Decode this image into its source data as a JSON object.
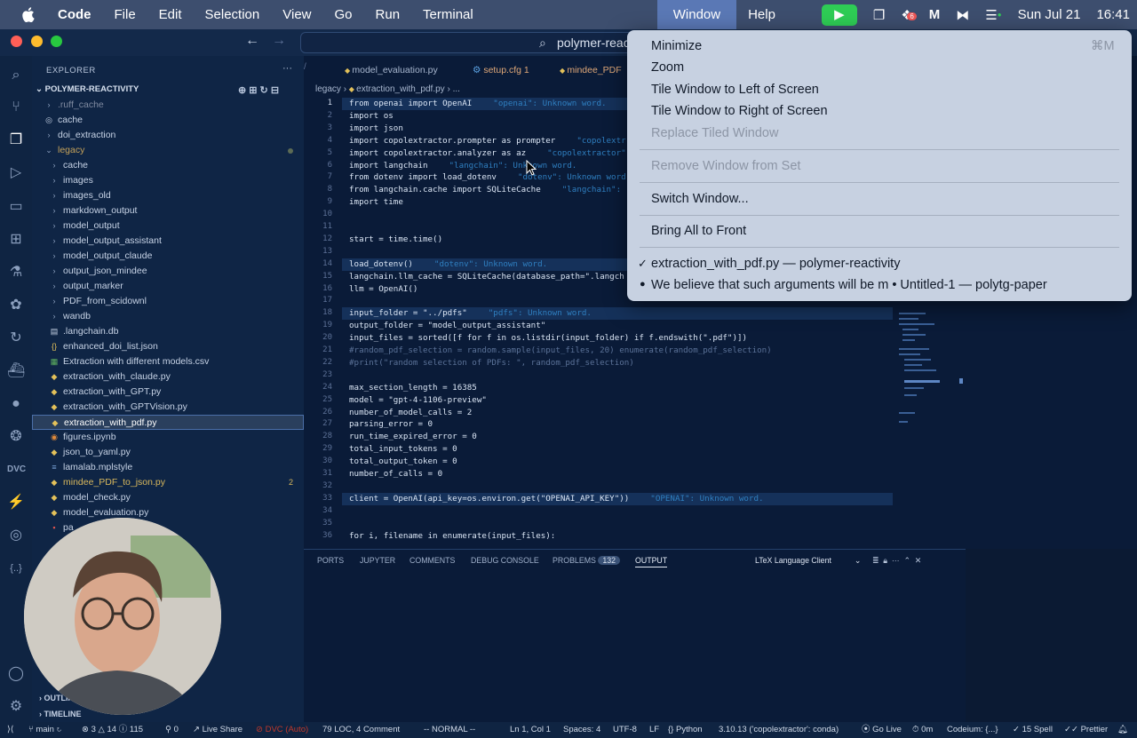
{
  "menubar": {
    "apple": "",
    "app": "Code",
    "items": [
      "File",
      "Edit",
      "Selection",
      "View",
      "Go",
      "Run",
      "Terminal",
      "Window",
      "Help"
    ],
    "date": "Sun Jul 21",
    "time": "16:41",
    "tray_badge": "6"
  },
  "window": {
    "command_center": "polymer-reac",
    "nav_back": "←",
    "nav_forward": "→"
  },
  "sidebar": {
    "title": "EXPLORER",
    "more": "···",
    "project": "POLYMER-REACTIVITY",
    "items": [
      {
        "label": ".ruff_cache",
        "icon": "›",
        "color": "#7f8aa0"
      },
      {
        "label": "cache",
        "icon": "◎",
        "color": "#c7d3e6"
      },
      {
        "label": "doi_extraction",
        "icon": "›",
        "color": "#c7d3e6"
      },
      {
        "label": "legacy",
        "icon": "⌄",
        "color": "#c5a25a"
      },
      {
        "label": "cache",
        "icon": "›",
        "color": "#c7d3e6"
      },
      {
        "label": "images",
        "icon": "›",
        "color": "#c7d3e6"
      },
      {
        "label": "images_old",
        "icon": "›",
        "color": "#c7d3e6"
      },
      {
        "label": "markdown_output",
        "icon": "›",
        "color": "#c7d3e6"
      },
      {
        "label": "model_output",
        "icon": "›",
        "color": "#c7d3e6"
      },
      {
        "label": "model_output_assistant",
        "icon": "›",
        "color": "#c7d3e6"
      },
      {
        "label": "model_output_claude",
        "icon": "›",
        "color": "#c7d3e6"
      },
      {
        "label": "output_json_mindee",
        "icon": "›",
        "color": "#c7d3e6"
      },
      {
        "label": "output_marker",
        "icon": "›",
        "color": "#c7d3e6"
      },
      {
        "label": "PDF_from_scidownl",
        "icon": "›",
        "color": "#c7d3e6"
      },
      {
        "label": "wandb",
        "icon": "›",
        "color": "#c7d3e6"
      },
      {
        "label": ".langchain.db",
        "icon": "▤",
        "color": "#c7d3e6"
      },
      {
        "label": "enhanced_doi_list.json",
        "icon": "{}",
        "color": "#c7d3e6"
      },
      {
        "label": "Extraction with different models.csv",
        "icon": "▦",
        "color": "#c7d3e6"
      },
      {
        "label": "extraction_with_claude.py",
        "icon": "◆",
        "color": "#c7d3e6"
      },
      {
        "label": "extraction_with_GPT.py",
        "icon": "◆",
        "color": "#c7d3e6"
      },
      {
        "label": "extraction_with_GPTVision.py",
        "icon": "◆",
        "color": "#c7d3e6"
      },
      {
        "label": "extraction_with_pdf.py",
        "icon": "◆",
        "color": "#ffffff"
      },
      {
        "label": "figures.ipynb",
        "icon": "◉",
        "color": "#c7d3e6"
      },
      {
        "label": "json_to_yaml.py",
        "icon": "◆",
        "color": "#c7d3e6"
      },
      {
        "label": "lamalab.mplstyle",
        "icon": "≡",
        "color": "#c7d3e6"
      },
      {
        "label": "mindee_PDF_to_json.py",
        "icon": "◆",
        "color": "#d9b85c"
      },
      {
        "label": "model_check.py",
        "icon": "◆",
        "color": "#c7d3e6"
      },
      {
        "label": "model_evaluation.py",
        "icon": "◆",
        "color": "#c7d3e6"
      },
      {
        "label": "pa",
        "icon": "▪",
        "color": "#c7d3e6"
      }
    ],
    "mindee_badge": "2",
    "outline": "OUTLINE",
    "timeline": "TIMELINE"
  },
  "editor": {
    "tabs": [
      {
        "label": "model_evaluation.py",
        "icon": "◆"
      },
      {
        "label": "setup.cfg",
        "badge": "1",
        "icon": "⚙"
      },
      {
        "label": "mindee_PDF",
        "icon": "◆"
      }
    ],
    "breadcrumb": [
      "legacy",
      "extraction_with_pdf.py",
      "..."
    ],
    "lines": [
      {
        "n": "1",
        "code": "from openai import OpenAI",
        "warn": "\"openai\": Unknown word.",
        "hl": true
      },
      {
        "n": "2",
        "code": "import os",
        "warn": ""
      },
      {
        "n": "3",
        "code": "import json",
        "warn": ""
      },
      {
        "n": "4",
        "code": "import copolextractor.prompter as prompter",
        "warn": "\"copolextr"
      },
      {
        "n": "5",
        "code": "import copolextractor.analyzer as az",
        "warn": "\"copolextractor\""
      },
      {
        "n": "6",
        "code": "import langchain",
        "warn": "\"langchain\": Unknown word."
      },
      {
        "n": "7",
        "code": "from dotenv import load_dotenv",
        "warn": "\"dotenv\": Unknown word"
      },
      {
        "n": "8",
        "code": "from langchain.cache import SQLiteCache",
        "warn": "\"langchain\":"
      },
      {
        "n": "9",
        "code": "import time",
        "warn": ""
      },
      {
        "n": "10",
        "code": "",
        "warn": ""
      },
      {
        "n": "11",
        "code": "",
        "warn": ""
      },
      {
        "n": "12",
        "code": "start = time.time()",
        "warn": ""
      },
      {
        "n": "13",
        "code": "",
        "warn": ""
      },
      {
        "n": "14",
        "code": "load_dotenv()",
        "warn": "\"dotenv\": Unknown word.",
        "hl": true
      },
      {
        "n": "15",
        "code": "langchain.llm_cache = SQLiteCache(database_path=\".langch",
        "warn": ""
      },
      {
        "n": "16",
        "code": "llm = OpenAI()",
        "warn": ""
      },
      {
        "n": "17",
        "code": "",
        "warn": ""
      },
      {
        "n": "18",
        "code": "input_folder = \"../pdfs\"",
        "warn": "\"pdfs\": Unknown word.",
        "hl": true
      },
      {
        "n": "19",
        "code": "output_folder = \"model_output_assistant\"",
        "warn": ""
      },
      {
        "n": "20",
        "code": "input_files = sorted([f for f in os.listdir(input_folder) if f.endswith(\".pdf\")])",
        "warn": ""
      },
      {
        "n": "21",
        "code": "#random_pdf_selection = random.sample(input_files, 20) enumerate(random_pdf_selection)",
        "warn": "",
        "comment": true
      },
      {
        "n": "22",
        "code": "#print(\"random selection of PDFs: \", random_pdf_selection)",
        "warn": "",
        "comment": true
      },
      {
        "n": "23",
        "code": "",
        "warn": ""
      },
      {
        "n": "24",
        "code": "max_section_length = 16385",
        "warn": ""
      },
      {
        "n": "25",
        "code": "model = \"gpt-4-1106-preview\"",
        "warn": ""
      },
      {
        "n": "26",
        "code": "number_of_model_calls = 2",
        "warn": ""
      },
      {
        "n": "27",
        "code": "parsing_error = 0",
        "warn": ""
      },
      {
        "n": "28",
        "code": "run_time_expired_error = 0",
        "warn": ""
      },
      {
        "n": "29",
        "code": "total_input_tokens = 0",
        "warn": ""
      },
      {
        "n": "30",
        "code": "total_output_token = 0",
        "warn": ""
      },
      {
        "n": "31",
        "code": "number_of_calls = 0",
        "warn": ""
      },
      {
        "n": "32",
        "code": "",
        "warn": ""
      },
      {
        "n": "33",
        "code": "client = OpenAI(api_key=os.environ.get(\"OPENAI_API_KEY\"))",
        "warn": "\"OPENAI\": Unknown word.",
        "hl": true
      },
      {
        "n": "34",
        "code": "",
        "warn": ""
      },
      {
        "n": "35",
        "code": "",
        "warn": ""
      },
      {
        "n": "36",
        "code": "for i, filename in enumerate(input_files):",
        "warn": ""
      }
    ]
  },
  "panel": {
    "tabs": [
      "PORTS",
      "JUPYTER",
      "COMMENTS",
      "DEBUG CONSOLE",
      "PROBLEMS",
      "OUTPUT"
    ],
    "problems_count": "132",
    "output_channel": "LTeX Language Client"
  },
  "window_menu": {
    "minimize": "Minimize",
    "minimize_shortcut": "⌘M",
    "zoom": "Zoom",
    "tile_left": "Tile Window to Left of Screen",
    "tile_right": "Tile Window to Right of Screen",
    "replace_tiled": "Replace Tiled Window",
    "remove_from_set": "Remove Window from Set",
    "switch_window": "Switch Window...",
    "bring_all_front": "Bring All to Front",
    "window_1": "extraction_with_pdf.py — polymer-reactivity",
    "window_1_mark": "✓",
    "window_2": "We believe that such arguments will be m • Untitled-1 — polytg-paper",
    "window_2_mark": "●"
  },
  "statusbar": {
    "branch": "main",
    "sync": "3",
    "errors": "14",
    "warnings": "115",
    "ports": "0",
    "live_share": "Live Share",
    "dvc": "DVC (Auto)",
    "loc": "79 LOC, 4 Comment",
    "mode": "-- NORMAL --",
    "position": "Ln 1, Col 1",
    "spaces": "Spaces: 4",
    "encoding": "UTF-8",
    "eol": "LF",
    "language": "Python",
    "interpreter": "3.10.13 ('copolextractor': conda)",
    "go_live": "Go Live",
    "timer": "0m",
    "codeium": "Codeium: {...}",
    "spell": "15 Spell",
    "prettier": "Prettier"
  }
}
